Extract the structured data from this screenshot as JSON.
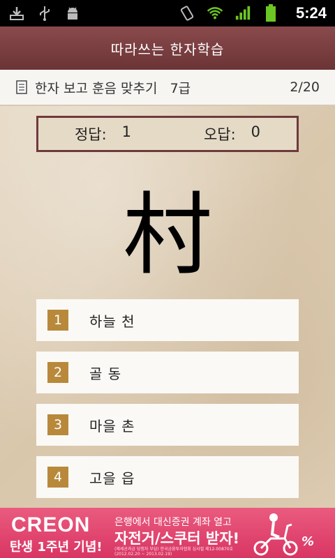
{
  "status_bar": {
    "left_icons": [
      "download-icon",
      "usb-icon",
      "android-debug-icon"
    ],
    "right_icons": [
      "vibrate-icon",
      "wifi-icon",
      "signal-icon",
      "battery-icon"
    ],
    "time": "5:24"
  },
  "header": {
    "title": "따라쓰는 한자학습"
  },
  "subheader": {
    "mode": "한자 보고 훈음 맞추기",
    "level": "7급",
    "progress": "2/20"
  },
  "score": {
    "correct_label": "정답:",
    "correct_value": "1",
    "wrong_label": "오답:",
    "wrong_value": "0"
  },
  "question": {
    "hanja": "村"
  },
  "options": [
    {
      "num": "1",
      "text": "하늘 천"
    },
    {
      "num": "2",
      "text": "골 동"
    },
    {
      "num": "3",
      "text": "마을 촌"
    },
    {
      "num": "4",
      "text": "고을 읍"
    }
  ],
  "ad": {
    "brand": "CREON",
    "tagline": "탄생 1주년 기념!",
    "line1": "은행에서 대신증권 계좌 열고",
    "line2": "자전거/스쿠터 받자!",
    "fine_print": "(제세공과금 당첨자 부담) 한국금융투자협회 심사필 제12-00870호 (2012.02.20 ~ 2013.02.19)",
    "percent_mark": "%",
    "colors": {
      "background": "#e04a72"
    }
  },
  "colors": {
    "title_bar": "#7a3f41",
    "score_border": "#6e3a3c",
    "option_number_bg": "#b8893b"
  }
}
